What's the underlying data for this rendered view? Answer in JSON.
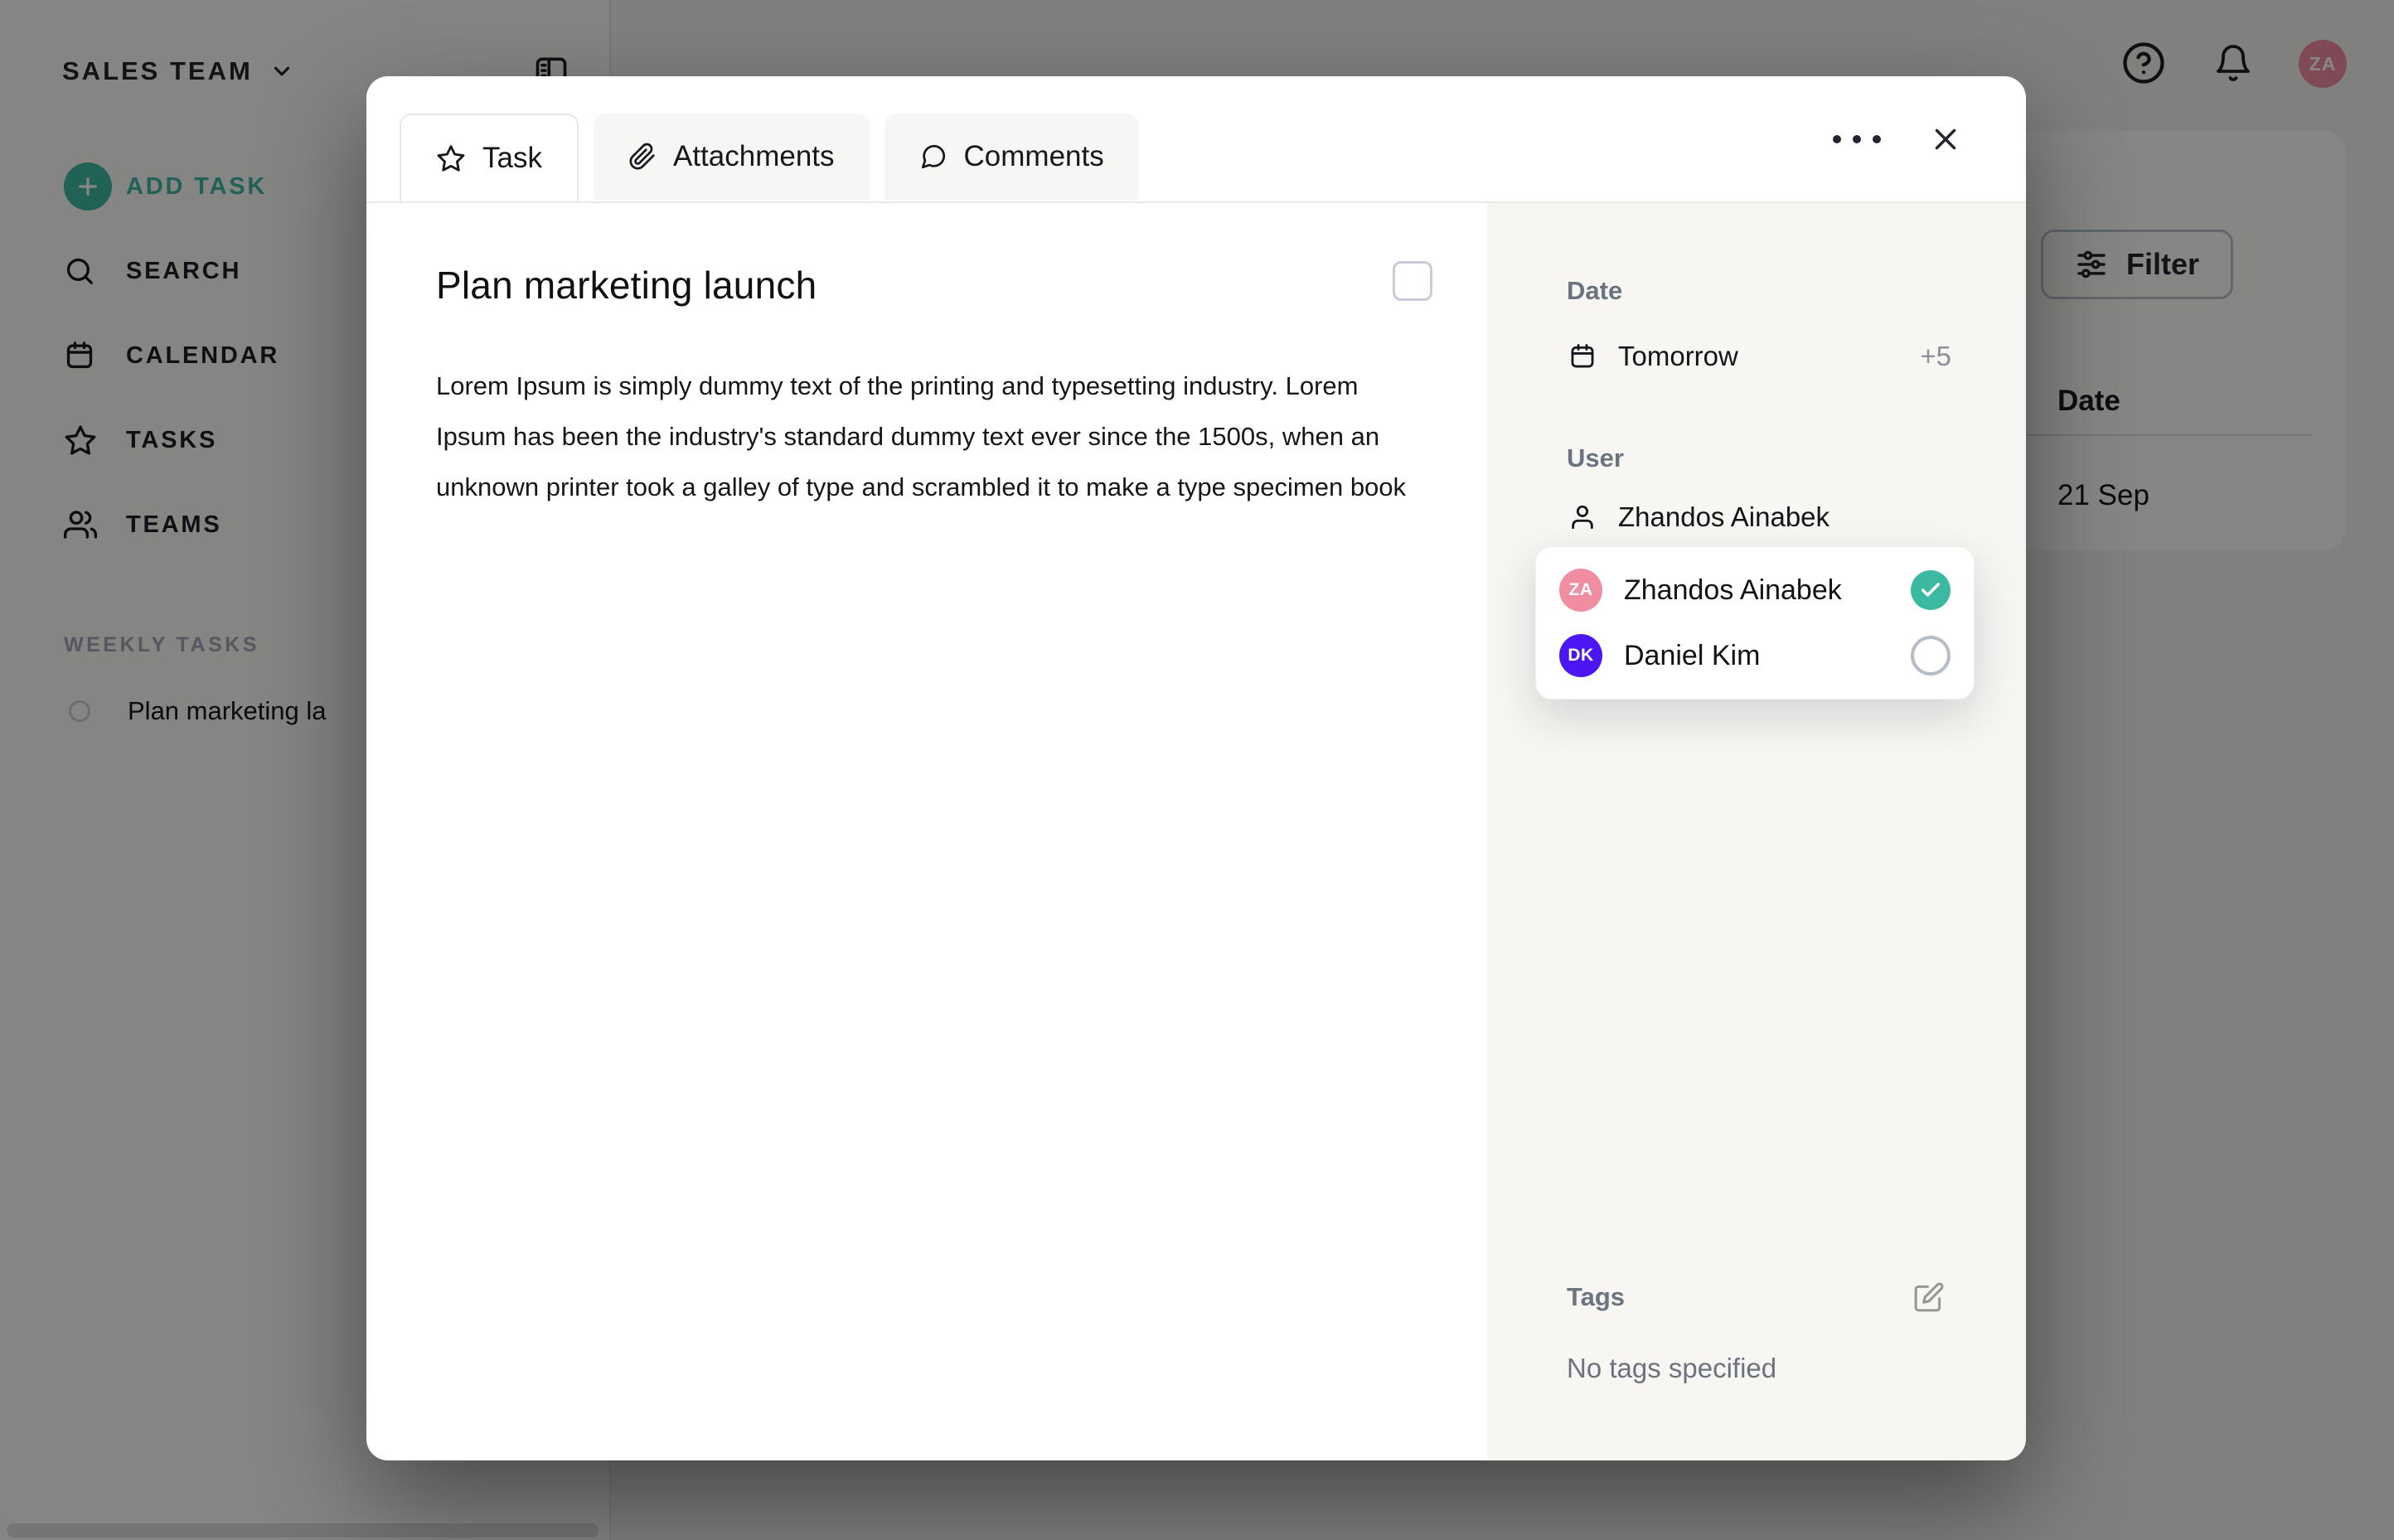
{
  "workspace": {
    "name": "SALES TEAM"
  },
  "sidebar": {
    "add_task_label": "ADD TASK",
    "items": [
      {
        "label": "SEARCH"
      },
      {
        "label": "CALENDAR"
      },
      {
        "label": "TASKS"
      },
      {
        "label": "TEAMS"
      }
    ],
    "section_title": "WEEKLY TASKS",
    "weekly_tasks": [
      {
        "title": "Plan marketing la"
      }
    ]
  },
  "topbar": {
    "avatar_initials": "ZA"
  },
  "background_page": {
    "filter_label": "Filter",
    "table": {
      "date_header": "Date",
      "rows": [
        {
          "date": "21 Sep"
        }
      ]
    }
  },
  "modal": {
    "tabs": [
      {
        "label": "Task"
      },
      {
        "label": "Attachments"
      },
      {
        "label": "Comments"
      }
    ],
    "active_tab": "Task",
    "task": {
      "title": "Plan marketing launch",
      "completed": false,
      "description": "Lorem Ipsum is simply dummy text of the printing and typesetting industry. Lorem Ipsum has been the industry's standard dummy text ever since the 1500s, when an unknown printer took a galley of type and scrambled it to make a type specimen book"
    },
    "panel": {
      "date": {
        "label": "Date",
        "value": "Tomorrow",
        "badge": "+5"
      },
      "user": {
        "label": "User",
        "value": "Zhandos Ainabek",
        "options": [
          {
            "initials": "ZA",
            "name": "Zhandos Ainabek",
            "selected": true,
            "avatar_color": "#f08da0"
          },
          {
            "initials": "DK",
            "name": "Daniel Kim",
            "selected": false,
            "avatar_color": "#4c16f2"
          }
        ]
      },
      "tags": {
        "label": "Tags",
        "empty_text": "No tags specified"
      }
    }
  },
  "colors": {
    "accent": "#3db9a0",
    "check": "#3cb9a1",
    "avatar_pink": "#f08da0",
    "avatar_purple": "#4c16f2"
  }
}
